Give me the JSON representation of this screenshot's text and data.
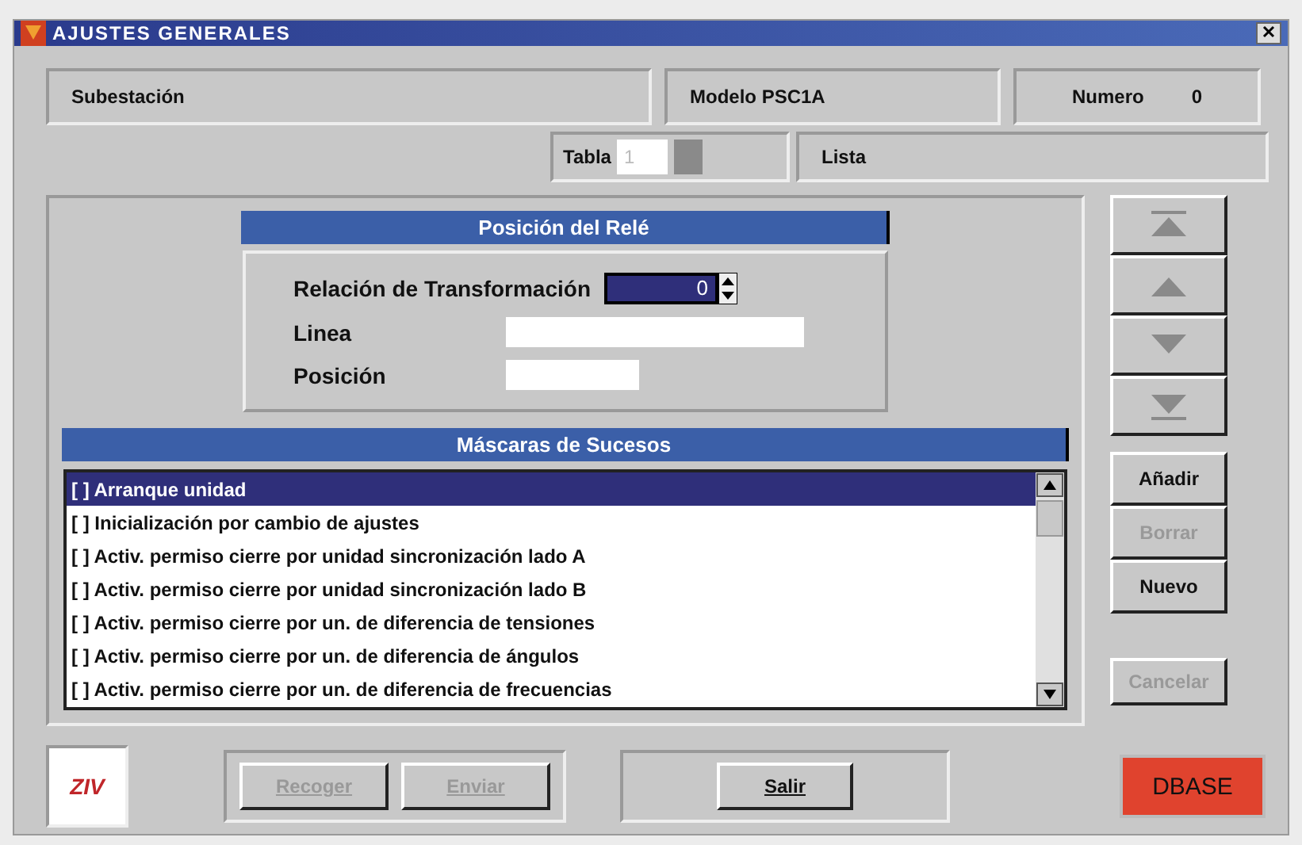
{
  "window": {
    "title": "AJUSTES GENERALES"
  },
  "header": {
    "substation_label": "Subestación",
    "model": "Modelo PSC1A",
    "number_label": "Numero",
    "number": "0"
  },
  "table": {
    "label": "Tabla",
    "value": "1",
    "list_label": "Lista"
  },
  "relay_position": {
    "title": "Posición del Relé",
    "ratio_label": "Relación de Transformación",
    "ratio_value": "0",
    "line_label": "Linea",
    "position_label": "Posición"
  },
  "event_masks": {
    "title": "Máscaras de Sucesos",
    "items": [
      {
        "label": "[ ] Arranque unidad",
        "selected": true
      },
      {
        "label": "[ ] Inicialización por cambio de ajustes",
        "selected": false
      },
      {
        "label": "[ ] Activ. permiso cierre por unidad sincronización lado A",
        "selected": false
      },
      {
        "label": "[ ] Activ. permiso cierre por unidad sincronización lado B",
        "selected": false
      },
      {
        "label": "[ ] Activ. permiso cierre por un. de diferencia de tensiones",
        "selected": false
      },
      {
        "label": "[ ] Activ. permiso cierre por un. de diferencia de ángulos",
        "selected": false
      },
      {
        "label": "[ ] Activ. permiso cierre por un. de diferencia de frecuencias",
        "selected": false
      }
    ]
  },
  "nav_buttons": [
    {
      "kind": "first"
    },
    {
      "kind": "up"
    },
    {
      "kind": "down"
    },
    {
      "kind": "last"
    }
  ],
  "side_buttons": [
    {
      "label": "Añadir",
      "disabled": false
    },
    {
      "label": "Borrar",
      "disabled": true
    },
    {
      "label": "Nuevo",
      "disabled": false
    }
  ],
  "cancel_button": {
    "label": "Cancelar",
    "disabled": true
  },
  "logo": {
    "text": "ZIV"
  },
  "transfer_buttons": [
    {
      "label": "Recoger",
      "disabled": true
    },
    {
      "label": "Enviar",
      "disabled": true
    }
  ],
  "exit_button": {
    "label": "Salir",
    "disabled": false
  },
  "dbase_button": {
    "label": "DBASE"
  }
}
